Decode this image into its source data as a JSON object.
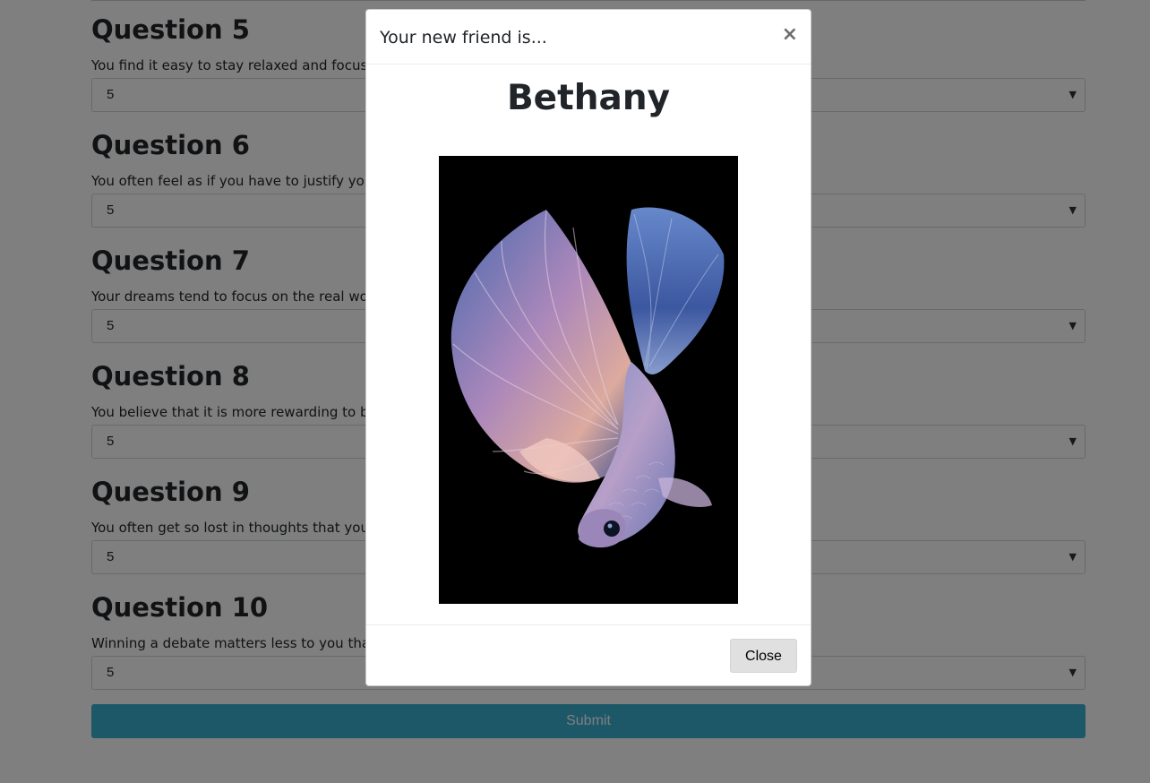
{
  "form": {
    "questions": [
      {
        "title": "Question 5",
        "text": "You find it easy to stay relaxed and focused",
        "value": "5"
      },
      {
        "title": "Question 6",
        "text": "You often feel as if you have to justify yours",
        "value": "5"
      },
      {
        "title": "Question 7",
        "text": "Your dreams tend to focus on the real world",
        "value": "5"
      },
      {
        "title": "Question 8",
        "text": "You believe that it is more rewarding to be l",
        "value": "5"
      },
      {
        "title": "Question 9",
        "text": "You often get so lost in thoughts that you ig",
        "value": "5"
      },
      {
        "title": "Question 10",
        "text": "Winning a debate matters less to you than m",
        "value": "5"
      }
    ],
    "submit_label": "Submit"
  },
  "modal": {
    "title": "Your new friend is...",
    "close_symbol": "×",
    "friend_name": "Bethany",
    "image_subject": "betta-fish",
    "close_label": "Close"
  },
  "colors": {
    "submit_bg": "#3ab0d3",
    "backdrop": "rgba(0,0,0,0.5)",
    "image_bg": "#000000"
  }
}
